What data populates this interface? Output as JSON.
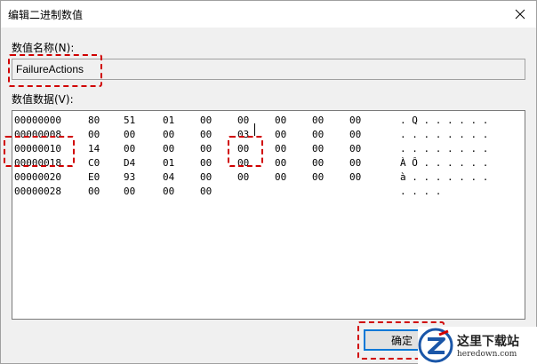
{
  "window": {
    "title": "编辑二进制数值"
  },
  "value_name": {
    "label": "数值名称(N):",
    "value": "FailureActions"
  },
  "value_data": {
    "label": "数值数据(V):",
    "rows": [
      {
        "addr": "00000000",
        "bytes": [
          "80",
          "51",
          "01",
          "00",
          "00",
          "00",
          "00",
          "00"
        ],
        "ascii": ". Q . . . . . ."
      },
      {
        "addr": "00000008",
        "bytes": [
          "00",
          "00",
          "00",
          "00",
          "03",
          "00",
          "00",
          "00"
        ],
        "ascii": ". . . . . . . ."
      },
      {
        "addr": "00000010",
        "bytes": [
          "14",
          "00",
          "00",
          "00",
          "00",
          "00",
          "00",
          "00"
        ],
        "ascii": ". . . . . . . ."
      },
      {
        "addr": "00000018",
        "bytes": [
          "C0",
          "D4",
          "01",
          "00",
          "00",
          "00",
          "00",
          "00"
        ],
        "ascii": "À Ô . . . . . ."
      },
      {
        "addr": "00000020",
        "bytes": [
          "E0",
          "93",
          "04",
          "00",
          "00",
          "00",
          "00",
          "00"
        ],
        "ascii": "à . . . . . . ."
      },
      {
        "addr": "00000028",
        "bytes": [
          "00",
          "00",
          "00",
          "00"
        ],
        "ascii": ". . . ."
      }
    ]
  },
  "buttons": {
    "ok": "确定"
  },
  "watermark": {
    "cn": "这里下载站",
    "en": "heredown.com"
  },
  "colors": {
    "accent": "#0078d7",
    "highlight": "#d00000"
  }
}
